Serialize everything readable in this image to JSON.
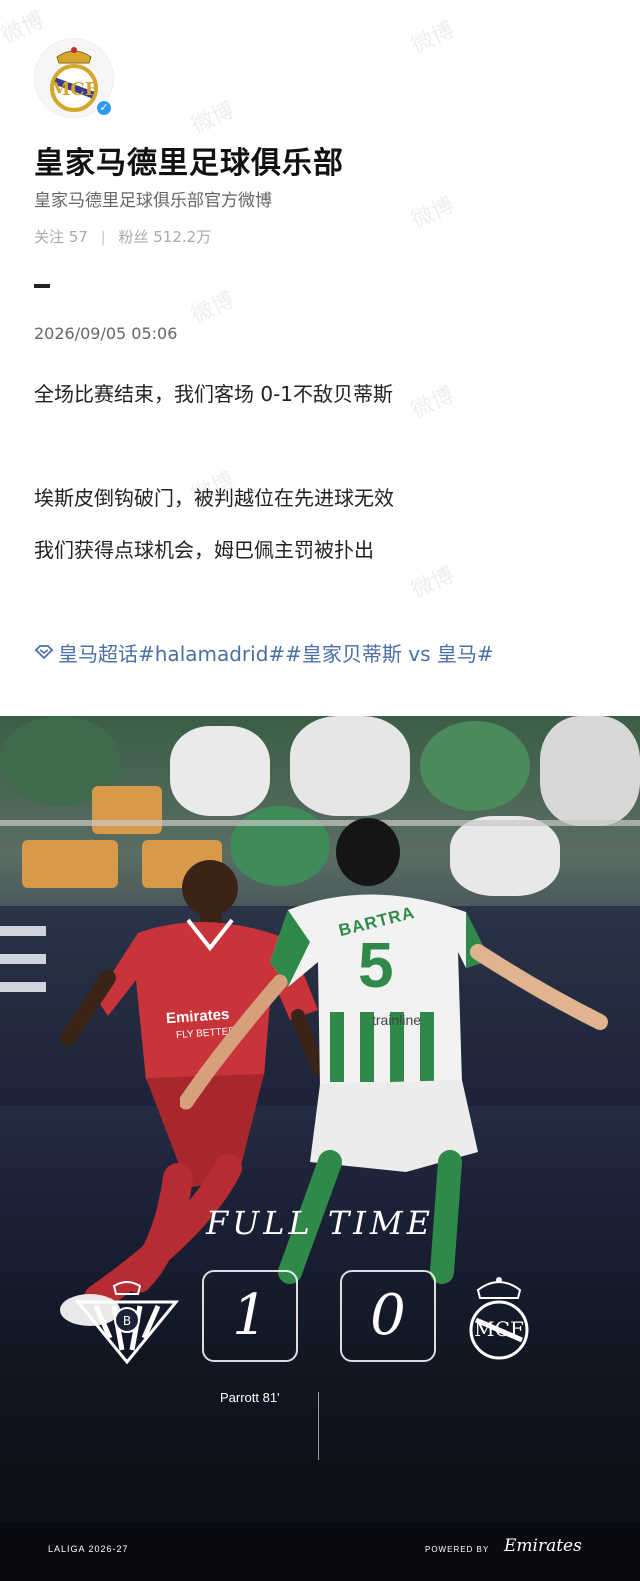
{
  "account": {
    "name": "皇家马德里足球俱乐部",
    "bio": "皇家马德里足球俱乐部官方微博",
    "following_label": "关注 57",
    "followers_label": "粉丝 512.2万",
    "separator": "|"
  },
  "post": {
    "timestamp": "2026/09/05 05:06",
    "lines": [
      "全场比赛结束，我们客场 0-1不敌贝蒂斯",
      "埃斯皮倒钩破门，被判越位在先进球无效",
      "我们获得点球机会，姆巴佩主罚被扑出"
    ],
    "tags": "皇马超话#halamadrid##皇家贝蒂斯 vs 皇马#"
  },
  "image": {
    "jersey_name": "BARTRA",
    "jersey_number": "5",
    "shirt_sponsor_green": "trainline",
    "shirt_sponsor_red": "Emirates",
    "shirt_sponsor_red_sub": "FLY BETTER",
    "full_time": "FULL TIME",
    "home_score": "1",
    "away_score": "0",
    "scorer": "Parrott 81'",
    "league": "LALIGA 2026-27",
    "powered_by": "POWERED BY",
    "sponsor": "Emirates"
  },
  "watermark": "微博",
  "colors": {
    "verify": "#2e9bf0",
    "tag_link": "#4a6fa5",
    "betis_green": "#2f8a4a",
    "real_red": "#c9343a"
  }
}
